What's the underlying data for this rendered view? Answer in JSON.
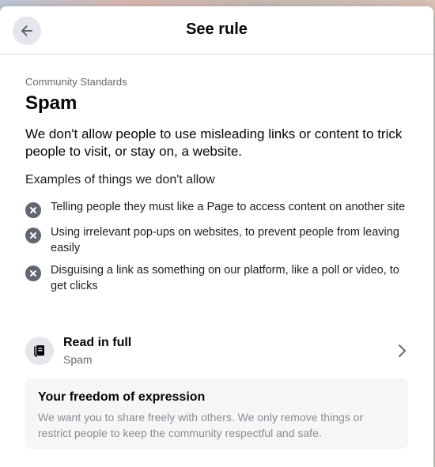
{
  "header": {
    "title": "See rule",
    "back_icon": "arrow-left-icon"
  },
  "rule": {
    "category": "Community Standards",
    "title": "Spam",
    "description": "We don't allow people to use misleading links or content to trick people to visit, or stay on, a website.",
    "examples_heading": "Examples of things we don't allow",
    "examples": [
      "Telling people they must like a Page to access content on another site",
      "Using irrelevant pop-ups on websites, to prevent people from leaving easily",
      "Disguising a link as something on our platform, like a poll or video, to get clicks"
    ]
  },
  "read_full": {
    "title": "Read in full",
    "subtitle": "Spam",
    "icon": "document-icon"
  },
  "freedom": {
    "title": "Your freedom of expression",
    "body": "We want you to share freely with others. We only remove things or restrict people to keep the community respectful and safe."
  },
  "colors": {
    "icon_bg": "#e4e6eb",
    "x_icon_bg": "#606770",
    "secondary_text": "#65676b",
    "card_bg": "#f5f6f7"
  }
}
